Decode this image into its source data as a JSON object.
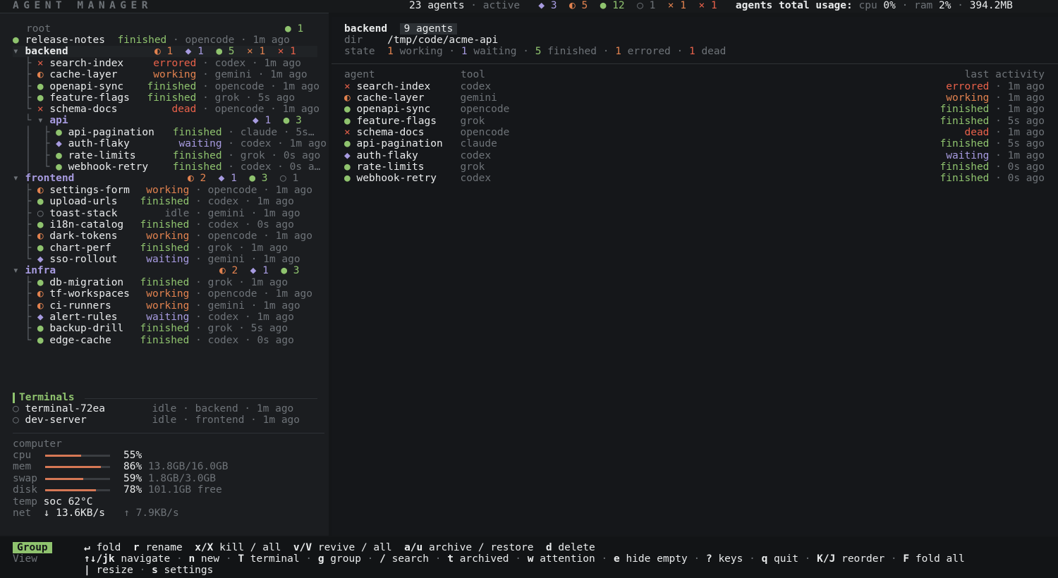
{
  "app_title": "AGENT MANAGER",
  "summary": {
    "agents_count": "23 agents",
    "active_label": "active",
    "waiting_glyph": "◆",
    "waiting_count": "3",
    "working_glyph": "◐",
    "working_count": "5",
    "finished_glyph": "●",
    "finished_count": "12",
    "idle_glyph": "○",
    "idle_count": "1",
    "errored_glyph": "×",
    "errored_count": "1",
    "dead_glyph": "×",
    "dead_count": "1",
    "usage_label": "agents total usage:",
    "cpu_label": "cpu",
    "cpu_value": "0%",
    "ram_label": "ram",
    "ram_value": "2%",
    "mem_value": "394.2MB"
  },
  "tree": {
    "root": {
      "label": "root",
      "finished_glyph": "●",
      "finished_count": "1"
    },
    "release_notes": {
      "name": "release-notes",
      "status": "finished",
      "tool": "opencode",
      "time": "1m ago"
    },
    "backend": {
      "label": "backend",
      "fold": "▾",
      "counts": {
        "working": "◐ 1",
        "waiting": "◆ 1",
        "finished": "● 5",
        "errored": "× 1",
        "dead": "× 1"
      },
      "items": [
        {
          "glyph": "×",
          "name": "search-index",
          "status": "errored",
          "tool": "codex",
          "time": "1m ago"
        },
        {
          "glyph": "◐",
          "name": "cache-layer",
          "status": "working",
          "tool": "gemini",
          "time": "1m ago"
        },
        {
          "glyph": "●",
          "name": "openapi-sync",
          "status": "finished",
          "tool": "opencode",
          "time": "1m ago"
        },
        {
          "glyph": "●",
          "name": "feature-flags",
          "status": "finished",
          "tool": "grok",
          "time": "5s ago"
        },
        {
          "glyph": "×",
          "name": "schema-docs",
          "status": "dead",
          "tool": "opencode",
          "time": "1m ago"
        }
      ],
      "api": {
        "label": "api",
        "fold": "▾",
        "counts": {
          "waiting": "◆ 1",
          "finished": "● 3"
        },
        "items": [
          {
            "glyph": "●",
            "name": "api-pagination",
            "status": "finished",
            "tool": "claude",
            "time": "5s…"
          },
          {
            "glyph": "◆",
            "name": "auth-flaky",
            "status": "waiting",
            "tool": "codex",
            "time": "1m ago"
          },
          {
            "glyph": "●",
            "name": "rate-limits",
            "status": "finished",
            "tool": "grok",
            "time": "0s ago"
          },
          {
            "glyph": "●",
            "name": "webhook-retry",
            "status": "finished",
            "tool": "codex",
            "time": "0s a…"
          }
        ]
      }
    },
    "frontend": {
      "label": "frontend",
      "fold": "▾",
      "counts": {
        "working": "◐ 2",
        "waiting": "◆ 1",
        "finished": "● 3",
        "idle": "○ 1"
      },
      "items": [
        {
          "glyph": "◐",
          "name": "settings-form",
          "status": "working",
          "tool": "opencode",
          "time": "1m ago"
        },
        {
          "glyph": "●",
          "name": "upload-urls",
          "status": "finished",
          "tool": "codex",
          "time": "1m ago"
        },
        {
          "glyph": "○",
          "name": "toast-stack",
          "status": "idle",
          "tool": "gemini",
          "time": "1m ago"
        },
        {
          "glyph": "●",
          "name": "i18n-catalog",
          "status": "finished",
          "tool": "codex",
          "time": "0s ago"
        },
        {
          "glyph": "◐",
          "name": "dark-tokens",
          "status": "working",
          "tool": "opencode",
          "time": "1m ago"
        },
        {
          "glyph": "●",
          "name": "chart-perf",
          "status": "finished",
          "tool": "grok",
          "time": "1m ago"
        },
        {
          "glyph": "◆",
          "name": "sso-rollout",
          "status": "waiting",
          "tool": "gemini",
          "time": "1m ago"
        }
      ]
    },
    "infra": {
      "label": "infra",
      "fold": "▾",
      "counts": {
        "working": "◐ 2",
        "waiting": "◆ 1",
        "finished": "● 3"
      },
      "items": [
        {
          "glyph": "●",
          "name": "db-migration",
          "status": "finished",
          "tool": "grok",
          "time": "1m ago"
        },
        {
          "glyph": "◐",
          "name": "tf-workspaces",
          "status": "working",
          "tool": "opencode",
          "time": "1m ago"
        },
        {
          "glyph": "◐",
          "name": "ci-runners",
          "status": "working",
          "tool": "gemini",
          "time": "1m ago"
        },
        {
          "glyph": "◆",
          "name": "alert-rules",
          "status": "waiting",
          "tool": "codex",
          "time": "1m ago"
        },
        {
          "glyph": "●",
          "name": "backup-drill",
          "status": "finished",
          "tool": "grok",
          "time": "5s ago"
        },
        {
          "glyph": "●",
          "name": "edge-cache",
          "status": "finished",
          "tool": "codex",
          "time": "0s ago"
        }
      ]
    }
  },
  "terminals": {
    "title": "Terminals",
    "items": [
      {
        "glyph": "○",
        "name": "terminal-72ea",
        "status": "idle",
        "group": "backend",
        "time": "1m ago"
      },
      {
        "glyph": "○",
        "name": "dev-server",
        "status": "idle",
        "group": "frontend",
        "time": "1m ago"
      }
    ]
  },
  "computer": {
    "title": "computer",
    "cpu": {
      "label": "cpu",
      "fraction": 0.55,
      "percent": "55%",
      "detail": ""
    },
    "mem": {
      "label": "mem",
      "fraction": 0.86,
      "percent": "86%",
      "detail": "13.8GB/16.0GB"
    },
    "swap": {
      "label": "swap",
      "fraction": 0.59,
      "percent": "59%",
      "detail": "1.8GB/3.0GB"
    },
    "disk": {
      "label": "disk",
      "fraction": 0.78,
      "percent": "78%",
      "detail": "101.1GB free"
    },
    "temp": {
      "label": "temp",
      "value": "soc 62°C"
    },
    "net": {
      "label": "net",
      "down": "↓ 13.6KB/s",
      "up": "↑ 7.9KB/s"
    }
  },
  "detail": {
    "group_name": "backend",
    "group_count": "9 agents",
    "dir_label": "dir",
    "dir_value": "/tmp/code/acme-api",
    "state_label": "state",
    "state": {
      "working": "1",
      "working_label": "working",
      "waiting": "1",
      "waiting_label": "waiting",
      "finished": "5",
      "finished_label": "finished",
      "errored": "1",
      "errored_label": "errored",
      "dead": "1",
      "dead_label": "dead"
    },
    "columns": {
      "agent": "agent",
      "tool": "tool",
      "last_activity": "last activity"
    },
    "rows": [
      {
        "glyph": "×",
        "name": "search-index",
        "tool": "codex",
        "status": "errored",
        "time": "1m ago"
      },
      {
        "glyph": "◐",
        "name": "cache-layer",
        "tool": "gemini",
        "status": "working",
        "time": "1m ago"
      },
      {
        "glyph": "●",
        "name": "openapi-sync",
        "tool": "opencode",
        "status": "finished",
        "time": "1m ago"
      },
      {
        "glyph": "●",
        "name": "feature-flags",
        "tool": "grok",
        "status": "finished",
        "time": "5s ago"
      },
      {
        "glyph": "×",
        "name": "schema-docs",
        "tool": "opencode",
        "status": "dead",
        "time": "1m ago"
      },
      {
        "glyph": "●",
        "name": "api-pagination",
        "tool": "claude",
        "status": "finished",
        "time": "5s ago"
      },
      {
        "glyph": "◆",
        "name": "auth-flaky",
        "tool": "codex",
        "status": "waiting",
        "time": "1m ago"
      },
      {
        "glyph": "●",
        "name": "rate-limits",
        "tool": "grok",
        "status": "finished",
        "time": "0s ago"
      },
      {
        "glyph": "●",
        "name": "webhook-retry",
        "tool": "codex",
        "status": "finished",
        "time": "0s ago"
      }
    ]
  },
  "footer": {
    "group_badge": "Group",
    "view_label": "View",
    "line1": [
      {
        "key": "↵",
        "desc": "fold"
      },
      {
        "key": "r",
        "desc": "rename"
      },
      {
        "key": "x/X",
        "desc": "kill / all"
      },
      {
        "key": "v/V",
        "desc": "revive / all"
      },
      {
        "key": "a/u",
        "desc": "archive / restore"
      },
      {
        "key": "d",
        "desc": "delete"
      }
    ],
    "line2": [
      {
        "key": "↑↓/jk",
        "desc": "navigate"
      },
      {
        "key": "n",
        "desc": "new"
      },
      {
        "key": "T",
        "desc": "terminal"
      },
      {
        "key": "g",
        "desc": "group"
      },
      {
        "key": "/",
        "desc": "search"
      },
      {
        "key": "t",
        "desc": "archived"
      },
      {
        "key": "w",
        "desc": "attention"
      },
      {
        "key": "e",
        "desc": "hide empty"
      },
      {
        "key": "?",
        "desc": "keys"
      },
      {
        "key": "q",
        "desc": "quit"
      },
      {
        "key": "K/J",
        "desc": "reorder"
      },
      {
        "key": "F",
        "desc": "fold all"
      }
    ],
    "line3": [
      {
        "key": "|",
        "desc": "resize"
      },
      {
        "key": "s",
        "desc": "settings"
      }
    ]
  },
  "colors": {
    "finished": "#8fc36e",
    "working": "#e2824f",
    "waiting": "#a79be0",
    "errored": "#e8614a",
    "dead": "#e8614a",
    "idle": "#6e7378",
    "accent": "#8fc36e"
  }
}
